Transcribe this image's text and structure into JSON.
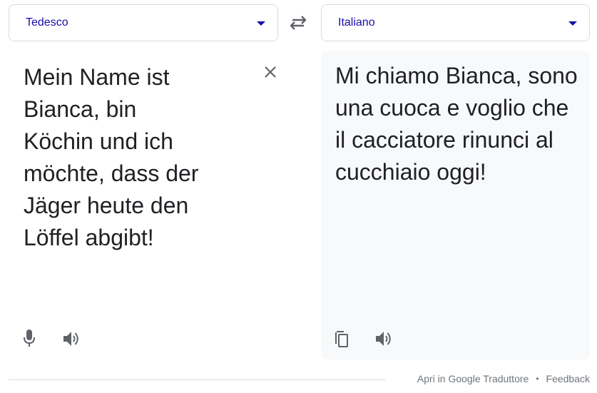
{
  "source_language": {
    "label": "Tedesco"
  },
  "target_language": {
    "label": "Italiano"
  },
  "source": {
    "text": "Mein Name ist\nBianca, bin\nKöchin und ich\nmöchte, dass der\nJäger heute den\nLöffel abgibt!"
  },
  "target": {
    "text": "Mi chiamo Bianca, sono una cuoca e voglio che il cacciatore rinunci al cucchiaio oggi!"
  },
  "footer": {
    "open_link": "Apri in Google Traduttore",
    "separator": "•",
    "feedback_link": "Feedback"
  },
  "colors": {
    "accent": "#1a0dab",
    "icon": "#5f6368",
    "target_bg": "#f8f9fa",
    "border": "#dadce0"
  },
  "icons": [
    "swap-icon",
    "clear-icon",
    "microphone-icon",
    "speaker-icon",
    "copy-icon",
    "caret-down-icon"
  ]
}
